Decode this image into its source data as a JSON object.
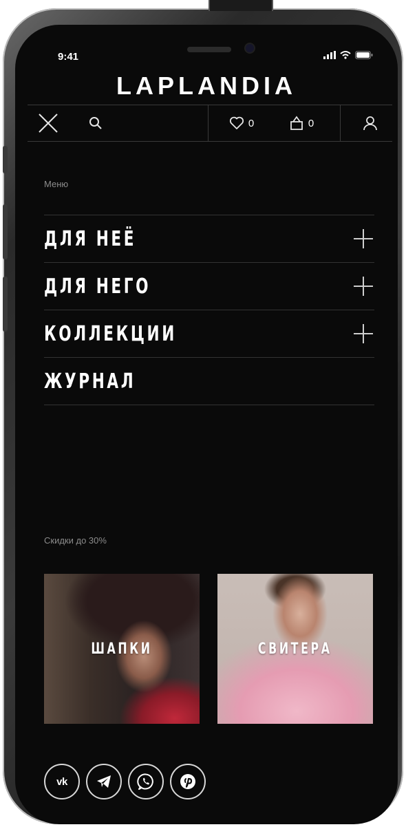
{
  "status": {
    "time": "9:41",
    "icons": [
      "signal-icon",
      "wifi-icon",
      "battery-icon"
    ]
  },
  "header": {
    "logo": "LAPLANDIA",
    "icons": {
      "close": "close-icon",
      "search": "search-icon",
      "favorites": "heart-icon",
      "cart": "bag-icon",
      "account": "user-icon"
    },
    "favorites_count": "0",
    "cart_count": "0"
  },
  "menu": {
    "label": "Меню",
    "items": [
      {
        "label": "ДЛЯ НЕЁ",
        "expandable": true
      },
      {
        "label": "ДЛЯ НЕГО",
        "expandable": true
      },
      {
        "label": "КОЛЛЕКЦИИ",
        "expandable": true
      },
      {
        "label": "ЖУРНАЛ",
        "expandable": false
      }
    ]
  },
  "promo": {
    "label": "Скидки до 30%",
    "cards": [
      {
        "title": "ШАПКИ"
      },
      {
        "title": "СВИТЕРА"
      }
    ]
  },
  "socials": [
    {
      "name": "vk",
      "icon": "vk-icon",
      "text": "vk"
    },
    {
      "name": "telegram",
      "icon": "telegram-icon"
    },
    {
      "name": "whatsapp",
      "icon": "whatsapp-icon"
    },
    {
      "name": "pinterest",
      "icon": "pinterest-icon"
    }
  ],
  "colors": {
    "background": "#0a0a0a",
    "text": "#ffffff",
    "muted": "#8c8c8c",
    "divider": "#333333"
  }
}
